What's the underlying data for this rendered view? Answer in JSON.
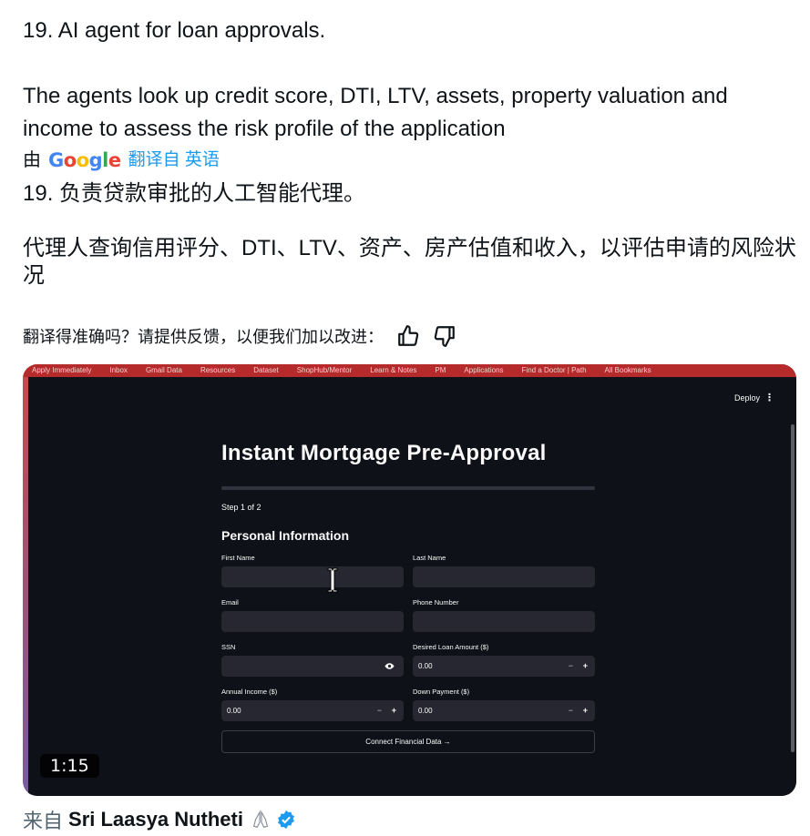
{
  "tweet": {
    "line1": "19. AI agent for loan approvals.",
    "line2": "The agents look up credit score, DTI, LTV, assets, property valuation and income to assess the risk profile of the application"
  },
  "translation": {
    "by": "由",
    "provider": "Google",
    "link": "翻译自 英语",
    "line1": "19. 负责贷款审批的人工智能代理。",
    "line2": "代理人查询信用评分、DTI、LTV、资产、房产估值和收入，以评估申请的风险状况",
    "feedback_prompt": "翻译得准确吗？请提供反馈，以便我们加以改进："
  },
  "video": {
    "timestamp": "1:15",
    "browser_tabs": [
      "Apply Immediately",
      "Inbox",
      "Gmail Data",
      "Resources",
      "Dataset",
      "ShopHub/Mentor",
      "Learn & Notes",
      "PM",
      "Applications",
      "Find a Doctor | Path",
      "All Bookmarks"
    ],
    "app": {
      "deploy_label": "Deploy",
      "menu_label": "⋮",
      "title": "Instant Mortgage Pre-Approval",
      "progress": 0.0,
      "step": "Step 1 of 2",
      "section": "Personal Information",
      "fields": {
        "first_name": {
          "label": "First Name",
          "value": ""
        },
        "last_name": {
          "label": "Last Name",
          "value": ""
        },
        "email": {
          "label": "Email",
          "value": ""
        },
        "phone": {
          "label": "Phone Number",
          "value": ""
        },
        "ssn": {
          "label": "SSN",
          "value": ""
        },
        "loan_amount": {
          "label": "Desired Loan Amount ($)",
          "value": "0.00"
        },
        "annual_income": {
          "label": "Annual Income ($)",
          "value": "0.00"
        },
        "down_payment": {
          "label": "Down Payment ($)",
          "value": "0.00"
        }
      },
      "minus": "−",
      "plus": "+",
      "connect_button": "Connect Financial Data →"
    }
  },
  "footer": {
    "from": "来自",
    "author": "Sri Laasya Nutheti"
  },
  "colors": {
    "link": "#1d9bf0",
    "verified": "#1d9bf0",
    "app_bg": "#0e1117",
    "input_bg": "#262730"
  }
}
